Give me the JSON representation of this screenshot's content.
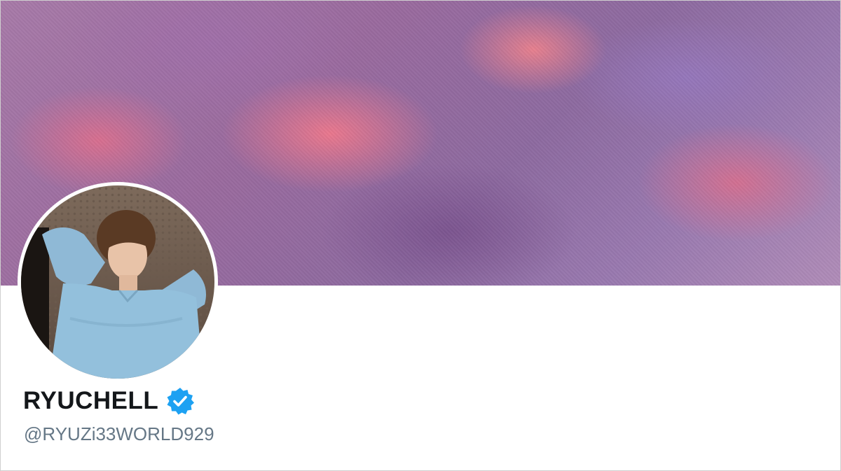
{
  "profile": {
    "display_name": "RYUCHELL",
    "handle": "@RYUZi33WORLD929",
    "verified": true
  },
  "icons": {
    "verified": "verified-badge-icon"
  },
  "colors": {
    "verified_blue": "#1da1f2",
    "name_text": "#14171a",
    "handle_text": "#657786"
  }
}
